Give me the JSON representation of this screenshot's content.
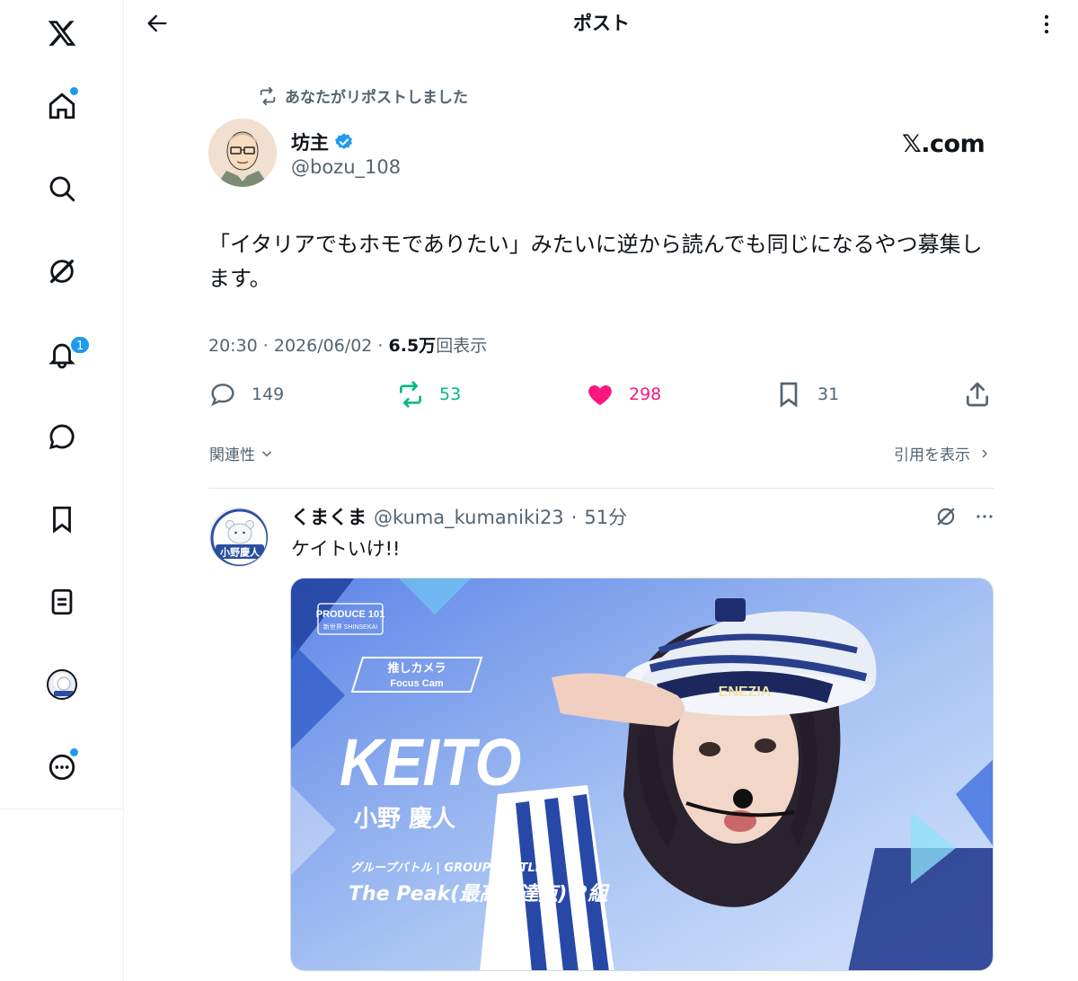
{
  "header": {
    "title": "ポスト"
  },
  "sidebar": {
    "notification_count": "1"
  },
  "post": {
    "repost_note": "あなたがリポストしました",
    "author_name": "坊主",
    "author_handle": "@bozu_108",
    "source_label": "𝕏.com",
    "text": "「イタリアでもホモでありたい」みたいに逆から読んでも同じになるやつ募集します。",
    "time": "20:30 · 2026/06/02 · ",
    "views_count": "6.5万",
    "views_label": "回表示",
    "replies": "149",
    "reposts": "53",
    "likes": "298",
    "bookmarks": "31"
  },
  "sort": {
    "label": "関連性",
    "quotes_link": "引用を表示"
  },
  "reply": {
    "name": "くまくま",
    "handle": "@kuma_kumaniki23",
    "separator": "·",
    "time": "51分",
    "text": "ケイトいけ!!",
    "avatar_text": "小野慶人",
    "media": {
      "brand": "PRODUCE 101",
      "brand_sub": "新世界 SHINSEKAI",
      "badge_top": "推しカメラ",
      "badge_bottom": "Focus Cam",
      "name_en": "KEITO",
      "name_jp": "小野 慶人",
      "category": "グループバトル | GROUP BATTLE",
      "song": "The Peak(最高到達点) 2組",
      "cap_text": "ENEZIA"
    }
  },
  "colors": {
    "accent": "#1d9bf0",
    "repost": "#00ba7c",
    "like": "#f91880",
    "muted": "#536471"
  }
}
